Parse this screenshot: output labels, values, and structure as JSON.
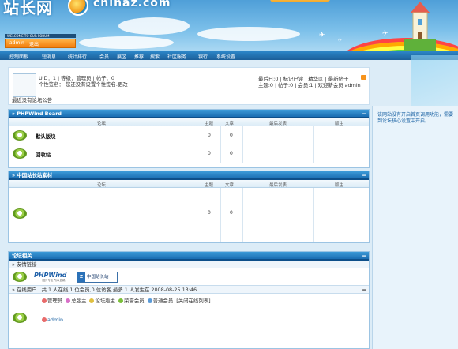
{
  "banner": {
    "logo_text": "站长网",
    "domain_fragment": "chinaz.com",
    "welcome_text": "WELCOME TO OUR FORUM",
    "login_user": "admin",
    "logout_label": "退出"
  },
  "nav": {
    "items": [
      "控制面板",
      "短消息",
      "统计排行",
      "会员",
      "展区",
      "推荐",
      "搜索",
      "社区服务",
      "银行",
      "系统设置"
    ]
  },
  "user_panel": {
    "line1": "UID：1 | 等级：管理员 | 帖子：0",
    "line2": "个性签名：  您还没有设置个性签名.更改",
    "right1": "最后日:0 | 标记已读 | 精华区 | 最新帖子",
    "right2": "主题:0 | 帖子:0 | 会员:1 | 欢迎新会员 admin",
    "notice": "最近没有论坛公告"
  },
  "sidebar": {
    "text": "该网站没有开启首页调用功能，需要到论坛核心设置中开启。"
  },
  "columns": {
    "forum": "论坛",
    "topics": "主题",
    "posts": "文章",
    "last_post": "最后发表",
    "moderator": "版主"
  },
  "sections": {
    "phpwind": {
      "title": "» PHPWind Board",
      "minimize": "═",
      "forums": [
        {
          "name": "默认版块",
          "topics": "0",
          "posts": "0"
        },
        {
          "name": "回收站",
          "topics": "0",
          "posts": "0"
        }
      ]
    },
    "chinaz": {
      "title": "» 中国站长站素材",
      "minimize": "═",
      "forum": {
        "name": "",
        "topics": "0",
        "posts": "0"
      }
    },
    "related": {
      "title": "论坛相关",
      "minimize": "═",
      "friend_links_label": "» 友情链接",
      "phpwind_logo": "PHPWind",
      "phpwind_slogan": "因为专业 所以信赖",
      "chinaz_logo_icon": "Z",
      "chinaz_logo": "中国站长站",
      "online_summary": "» 在线用户 · 共 1 人在线,1 位会员,0 位访客,最多 1 人发生在 2008-08-25 13:46",
      "legend": [
        {
          "label": "管理员",
          "color": "#e86b6b"
        },
        {
          "label": "总版主",
          "color": "#d870c8"
        },
        {
          "label": "论坛版主",
          "color": "#e0c040"
        },
        {
          "label": "荣誉会员",
          "color": "#7bbf3a"
        },
        {
          "label": "普通会员",
          "color": "#5b9bd8"
        },
        {
          "label": "[关闭在线列表]",
          "color": ""
        }
      ],
      "online_user": "admin"
    }
  }
}
